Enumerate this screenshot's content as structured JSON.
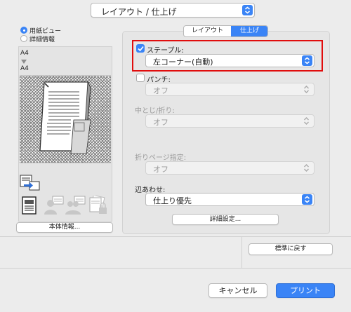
{
  "window": {
    "panel_select": {
      "value": "レイアウト / 仕上げ",
      "icon": "chevron-updown-icon"
    }
  },
  "view": {
    "options": [
      {
        "label": "用紙ビュー",
        "selected": true
      },
      {
        "label": "詳細情報",
        "selected": false
      }
    ]
  },
  "preview": {
    "paper_top": "A4",
    "paper_bottom": "A4",
    "device_info_button": "本体情報..."
  },
  "tabs": {
    "items": [
      {
        "label": "レイアウト",
        "active": false
      },
      {
        "label": "仕上げ",
        "active": true
      }
    ]
  },
  "finishing": {
    "staple": {
      "label": "ステープル:",
      "checked": true,
      "value": "左コーナー(自動)"
    },
    "punch": {
      "label": "パンチ:",
      "checked": false,
      "value": "オフ"
    },
    "fold": {
      "label": "中とじ/折り:",
      "value": "オフ"
    },
    "fold_page": {
      "label": "折りページ指定:",
      "value": "オフ"
    },
    "binding": {
      "label": "辺あわせ:",
      "value": "仕上り優先"
    },
    "detail_button": "詳細設定..."
  },
  "footer": {
    "reset_button": "標準に戻す",
    "cancel_button": "キャンセル",
    "print_button": "プリント"
  },
  "colors": {
    "accent": "#3a84f6",
    "highlight": "#e10d0d"
  }
}
